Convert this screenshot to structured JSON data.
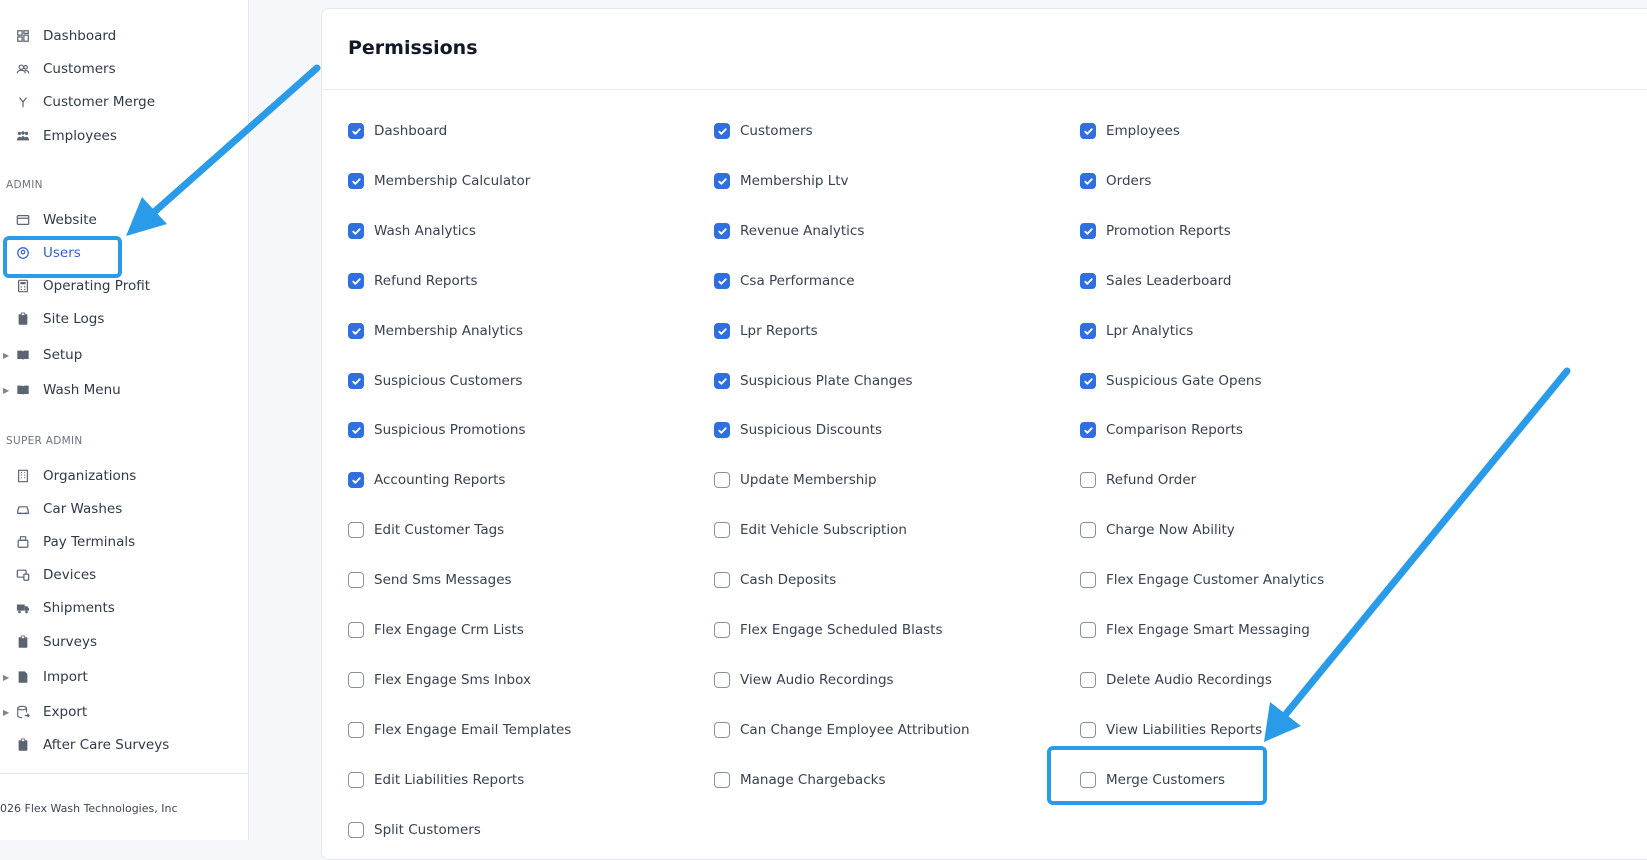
{
  "sidebar": {
    "top_items": [
      {
        "label": "Dashboard",
        "icon": "dashboard-grid-icon"
      },
      {
        "label": "Customers",
        "icon": "users-icon"
      },
      {
        "label": "Customer Merge",
        "icon": "merge-icon"
      },
      {
        "label": "Employees",
        "icon": "employees-icon"
      }
    ],
    "admin_label": "ADMIN",
    "admin_items": [
      {
        "label": "Website",
        "icon": "browser-window-icon"
      },
      {
        "label": "Users",
        "icon": "user-circle-icon",
        "active": true
      },
      {
        "label": "Operating Profit",
        "icon": "calculator-icon"
      },
      {
        "label": "Site Logs",
        "icon": "clipboard-icon"
      },
      {
        "label": "Setup",
        "icon": "book-icon",
        "expandable": true
      },
      {
        "label": "Wash Menu",
        "icon": "book-icon",
        "expandable": true
      }
    ],
    "super_admin_label": "SUPER ADMIN",
    "super_admin_items": [
      {
        "label": "Organizations",
        "icon": "building-icon"
      },
      {
        "label": "Car Washes",
        "icon": "car-icon"
      },
      {
        "label": "Pay Terminals",
        "icon": "terminal-icon"
      },
      {
        "label": "Devices",
        "icon": "devices-icon"
      },
      {
        "label": "Shipments",
        "icon": "truck-icon"
      },
      {
        "label": "Surveys",
        "icon": "clipboard-icon"
      },
      {
        "label": "Import",
        "icon": "file-csv-icon",
        "expandable": true
      },
      {
        "label": "Export",
        "icon": "database-export-icon",
        "expandable": true
      },
      {
        "label": "After Care Surveys",
        "icon": "clipboard-check-icon"
      }
    ],
    "copyright": "026 Flex Wash Technologies, Inc"
  },
  "permissions": {
    "title": "Permissions",
    "columns": [
      [
        {
          "label": "Dashboard",
          "checked": true
        },
        {
          "label": "Membership Calculator",
          "checked": true
        },
        {
          "label": "Wash Analytics",
          "checked": true
        },
        {
          "label": "Refund Reports",
          "checked": true
        },
        {
          "label": "Membership Analytics",
          "checked": true
        },
        {
          "label": "Suspicious Customers",
          "checked": true
        },
        {
          "label": "Suspicious Promotions",
          "checked": true
        },
        {
          "label": "Accounting Reports",
          "checked": true
        },
        {
          "label": "Edit Customer Tags",
          "checked": false
        },
        {
          "label": "Send Sms Messages",
          "checked": false
        },
        {
          "label": "Flex Engage Crm Lists",
          "checked": false
        },
        {
          "label": "Flex Engage Sms Inbox",
          "checked": false
        },
        {
          "label": "Flex Engage Email Templates",
          "checked": false
        },
        {
          "label": "Edit Liabilities Reports",
          "checked": false
        },
        {
          "label": "Split Customers",
          "checked": false
        }
      ],
      [
        {
          "label": "Customers",
          "checked": true
        },
        {
          "label": "Membership Ltv",
          "checked": true
        },
        {
          "label": "Revenue Analytics",
          "checked": true
        },
        {
          "label": "Csa Performance",
          "checked": true
        },
        {
          "label": "Lpr Reports",
          "checked": true
        },
        {
          "label": "Suspicious Plate Changes",
          "checked": true
        },
        {
          "label": "Suspicious Discounts",
          "checked": true
        },
        {
          "label": "Update Membership",
          "checked": false
        },
        {
          "label": "Edit Vehicle Subscription",
          "checked": false
        },
        {
          "label": "Cash Deposits",
          "checked": false
        },
        {
          "label": "Flex Engage Scheduled Blasts",
          "checked": false
        },
        {
          "label": "View Audio Recordings",
          "checked": false
        },
        {
          "label": "Can Change Employee Attribution",
          "checked": false
        },
        {
          "label": "Manage Chargebacks",
          "checked": false
        }
      ],
      [
        {
          "label": "Employees",
          "checked": true
        },
        {
          "label": "Orders",
          "checked": true
        },
        {
          "label": "Promotion Reports",
          "checked": true
        },
        {
          "label": "Sales Leaderboard",
          "checked": true
        },
        {
          "label": "Lpr Analytics",
          "checked": true
        },
        {
          "label": "Suspicious Gate Opens",
          "checked": true
        },
        {
          "label": "Comparison Reports",
          "checked": true
        },
        {
          "label": "Refund Order",
          "checked": false
        },
        {
          "label": "Charge Now Ability",
          "checked": false
        },
        {
          "label": "Flex Engage Customer Analytics",
          "checked": false
        },
        {
          "label": "Flex Engage Smart Messaging",
          "checked": false
        },
        {
          "label": "Delete Audio Recordings",
          "checked": false
        },
        {
          "label": "View Liabilities Reports",
          "checked": false
        },
        {
          "label": "Merge Customers",
          "checked": false
        }
      ]
    ]
  },
  "annotations": {
    "color": "#2a9be8",
    "highlights": [
      "Users",
      "Merge Customers"
    ]
  }
}
